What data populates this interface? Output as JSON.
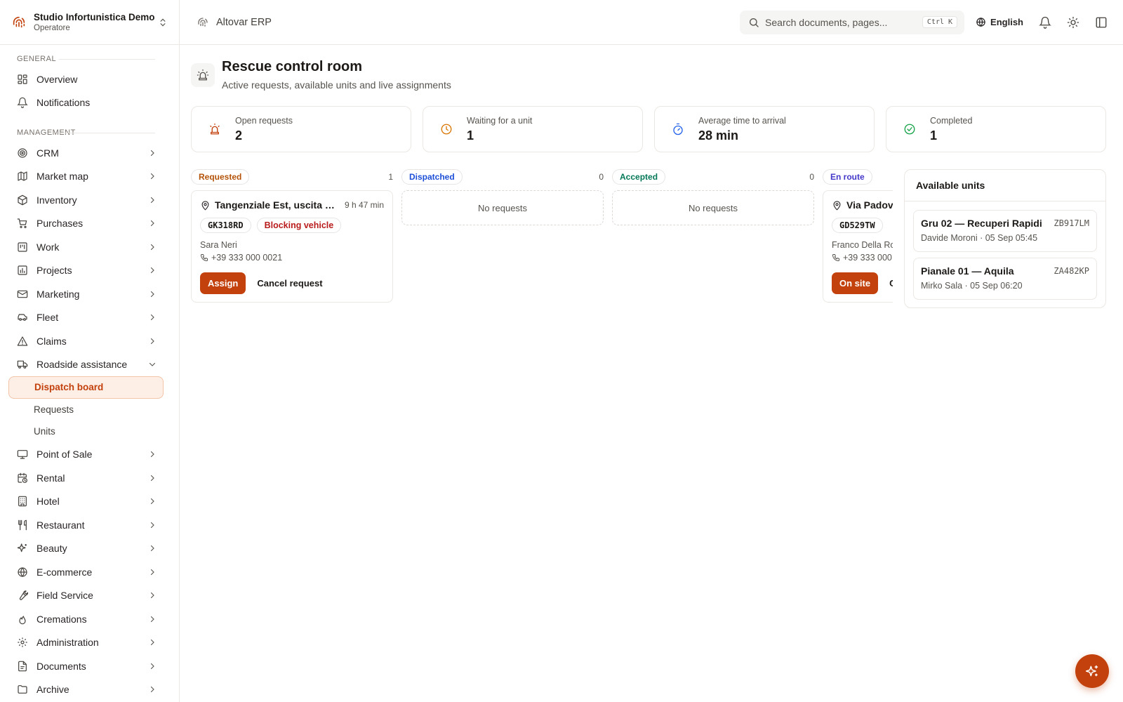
{
  "org": {
    "name": "Studio Infortunistica Demo",
    "role": "Operatore"
  },
  "topbar": {
    "app_name": "Altovar ERP",
    "search_placeholder": "Search documents, pages...",
    "shortcut": "Ctrl K",
    "language": "English"
  },
  "sidebar": {
    "general_label": "GENERAL",
    "general": [
      {
        "label": "Overview",
        "icon": "grid-icon"
      },
      {
        "label": "Notifications",
        "icon": "bell-icon"
      }
    ],
    "management_label": "MANAGEMENT",
    "management": [
      {
        "label": "CRM",
        "icon": "target-icon"
      },
      {
        "label": "Market map",
        "icon": "map-icon"
      },
      {
        "label": "Inventory",
        "icon": "box-icon"
      },
      {
        "label": "Purchases",
        "icon": "cart-icon"
      },
      {
        "label": "Work",
        "icon": "kanban-icon"
      },
      {
        "label": "Projects",
        "icon": "chart-icon"
      },
      {
        "label": "Marketing",
        "icon": "mail-icon"
      },
      {
        "label": "Fleet",
        "icon": "car-icon"
      },
      {
        "label": "Claims",
        "icon": "warning-icon"
      },
      {
        "label": "Roadside assistance",
        "icon": "truck-icon"
      }
    ],
    "roadside_sub": [
      {
        "label": "Dispatch board"
      },
      {
        "label": "Requests"
      },
      {
        "label": "Units"
      }
    ],
    "management_more": [
      {
        "label": "Point of Sale",
        "icon": "monitor-icon"
      },
      {
        "label": "Rental",
        "icon": "calendar-clock-icon"
      },
      {
        "label": "Hotel",
        "icon": "building-icon"
      },
      {
        "label": "Restaurant",
        "icon": "utensils-icon"
      },
      {
        "label": "Beauty",
        "icon": "sparkles-icon"
      },
      {
        "label": "E-commerce",
        "icon": "globe-icon"
      },
      {
        "label": "Field Service",
        "icon": "wrench-icon"
      },
      {
        "label": "Cremations",
        "icon": "flame-icon"
      },
      {
        "label": "Administration",
        "icon": "gear-icon"
      },
      {
        "label": "Documents",
        "icon": "file-icon"
      },
      {
        "label": "Archive",
        "icon": "folder-icon"
      }
    ]
  },
  "page": {
    "title": "Rescue control room",
    "subtitle": "Active requests, available units and live assignments"
  },
  "stats": [
    {
      "label": "Open requests",
      "value": "2",
      "icon": "siren-icon",
      "color": "#c2410c"
    },
    {
      "label": "Waiting for a unit",
      "value": "1",
      "icon": "clock-icon",
      "color": "#d97706"
    },
    {
      "label": "Average time to arrival",
      "value": "28 min",
      "icon": "timer-icon",
      "color": "#2563eb"
    },
    {
      "label": "Completed",
      "value": "1",
      "icon": "check-circle-icon",
      "color": "#16a34a"
    }
  ],
  "columns": [
    {
      "label": "Requested",
      "count": "1",
      "color": "#b45309"
    },
    {
      "label": "Dispatched",
      "count": "0",
      "color": "#1d4ed8",
      "empty": "No requests"
    },
    {
      "label": "Accepted",
      "count": "0",
      "color": "#047857",
      "empty": "No requests"
    },
    {
      "label": "En route",
      "color": "#4338ca"
    }
  ],
  "cards": {
    "requested": {
      "address": "Tangenziale Est, uscita R...",
      "age": "9 h 47 min",
      "plate": "GK318RD",
      "flag": "Blocking vehicle",
      "person": "Sara Neri",
      "phone": "+39 333 000 0021",
      "primary": "Assign",
      "secondary": "Cancel request"
    },
    "enroute": {
      "address": "Via Padov",
      "plate": "GD529TW",
      "person": "Franco Della Ro",
      "phone": "+39 333 000",
      "primary": "On site",
      "secondary": "C"
    }
  },
  "units": {
    "title": "Available units",
    "items": [
      {
        "name": "Gru 02 — Recuperi Rapidi",
        "plate": "ZB917LM",
        "meta": "Davide Moroni · 05 Sep 05:45"
      },
      {
        "name": "Pianale 01 — Aquila",
        "plate": "ZA482KP",
        "meta": "Mirko Sala · 05 Sep 06:20"
      }
    ]
  },
  "colors": {
    "accent": "#c2410c",
    "accent_bg": "#fdeee6"
  }
}
